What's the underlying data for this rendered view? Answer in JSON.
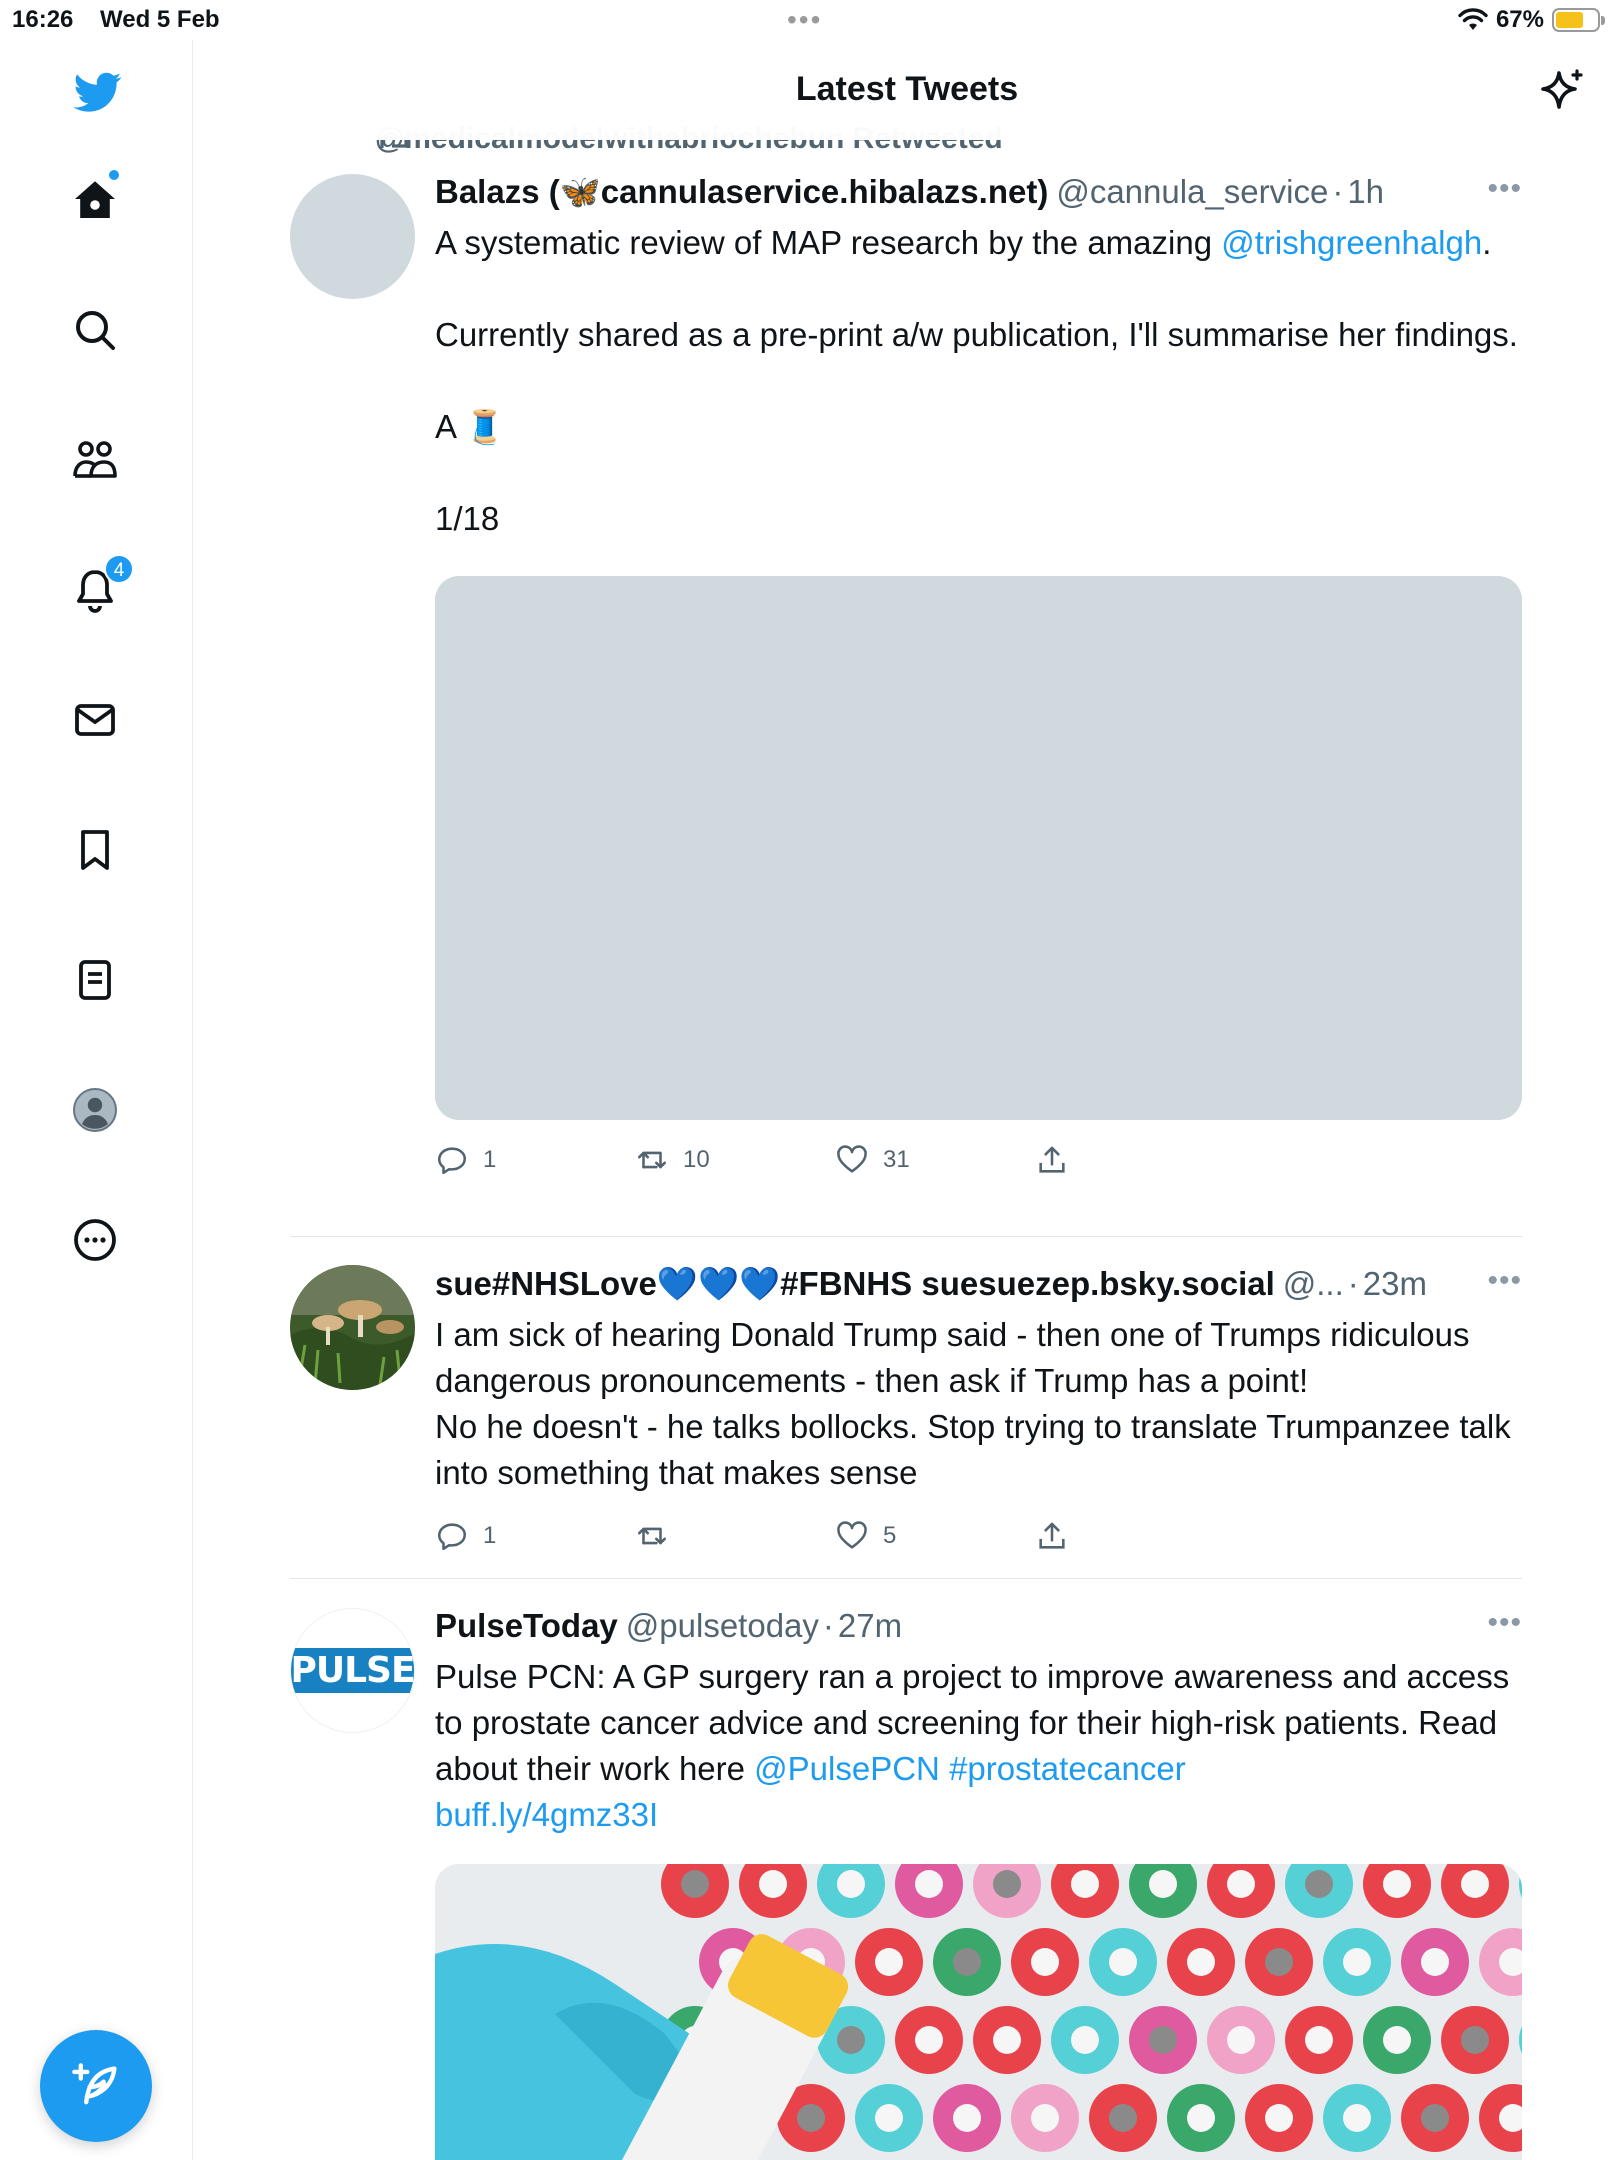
{
  "status_bar": {
    "time": "16:26",
    "date": "Wed 5 Feb",
    "battery_percent": "67%",
    "battery_level": 0.67
  },
  "header": {
    "title": "Latest Tweets"
  },
  "sidebar": {
    "items": [
      {
        "name": "home",
        "icon": "home-icon",
        "has_dot": true
      },
      {
        "name": "explore",
        "icon": "search-icon"
      },
      {
        "name": "communities",
        "icon": "communities-icon"
      },
      {
        "name": "notifications",
        "icon": "bell-icon",
        "badge": "4"
      },
      {
        "name": "messages",
        "icon": "mail-icon"
      },
      {
        "name": "bookmarks",
        "icon": "bookmark-icon"
      },
      {
        "name": "lists",
        "icon": "list-icon"
      },
      {
        "name": "profile",
        "icon": "avatar-icon"
      },
      {
        "name": "more",
        "icon": "more-circle-icon"
      }
    ],
    "compose_icon": "compose-icon"
  },
  "retweet_context": "@medicalmodelwithabriochebun Retweeted",
  "tweets": [
    {
      "name": "Balazs (🦋cannulaservice.hibalazs.net)",
      "handle": "@cannula_service",
      "sep": "·",
      "time": "1h",
      "text_before": "A systematic review of MAP research by the amazing ",
      "mention": "@trishgreenhalgh",
      "text_after": ".\n\nCurrently shared as a pre-print a/w publication, I'll summarise her findings.\n\nA 🧵\n\n1/18",
      "replies": "1",
      "retweets": "10",
      "likes": "31"
    },
    {
      "name": "sue#NHSLove💙💙💙#FBNHS suesuezep.bsky.social",
      "handle": "@...",
      "sep": "·",
      "time": "23m",
      "text": "I am sick of hearing Donald Trump said - then one of Trumps ridiculous dangerous pronouncements - then ask if Trump has a point!\nNo he doesn't - he talks bollocks. Stop trying to translate Trumpanzee talk into something that makes sense",
      "replies": "1",
      "retweets": "",
      "likes": "5"
    },
    {
      "name": "PulseToday",
      "handle": "@pulsetoday",
      "sep": "·",
      "time": "27m",
      "logo_text": "PULSE",
      "text": "Pulse PCN: A GP surgery ran a project to improve awareness and access to prostate cancer advice and screening for their high-risk patients. Read about their work here ",
      "link1": "@PulsePCN",
      "link2": "#prostatecancer",
      "link3": "buff.ly/4gmz33I"
    }
  ],
  "colors": {
    "accent": "#1d9bf0",
    "secondary_text": "#536471",
    "divider": "#e1e8ed",
    "media_placeholder": "#cfd9de"
  }
}
